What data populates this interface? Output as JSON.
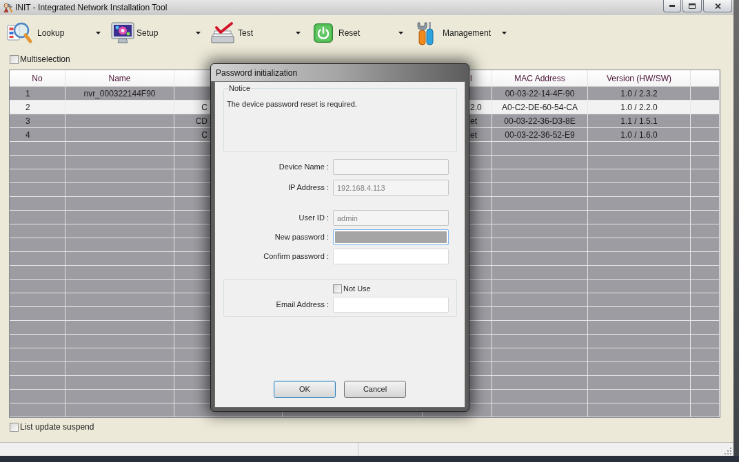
{
  "window": {
    "title": "INIT - Integrated Network Installation Tool"
  },
  "toolbar": [
    {
      "label": "Lookup"
    },
    {
      "label": "Setup"
    },
    {
      "label": "Test"
    },
    {
      "label": "Reset"
    },
    {
      "label": "Management"
    }
  ],
  "multiselection": {
    "label": "Multiselection",
    "checked": false
  },
  "table": {
    "columns": {
      "no": "No",
      "name": "Name",
      "column_5": "l",
      "mac_address": "MAC Address",
      "version": "Version (HW/SW)"
    },
    "rows": [
      {
        "no": "1",
        "name": "nvr_000322144F90",
        "mac_address": "00-03-22-14-4F-90",
        "version": "1.0 / 2.3.2",
        "selected": false
      },
      {
        "no": "2",
        "column_3": "C",
        "column_5": "2.0",
        "mac_address": "A0-C2-DE-60-54-CA",
        "version": "1.0 / 2.2.0",
        "selected": true
      },
      {
        "no": "3",
        "column_3": "CD",
        "column_5": "et",
        "mac_address": "00-03-22-36-D3-8E",
        "version": "1.1 / 1.5.1",
        "selected": false
      },
      {
        "no": "4",
        "column_3": "C",
        "column_5": "et",
        "mac_address": "00-03-22-36-52-E9",
        "version": "1.0 / 1.6.0",
        "selected": false
      }
    ]
  },
  "list_update_suspend": {
    "label": "List update suspend",
    "checked": false
  },
  "dialog": {
    "title": "Password initialization",
    "notice": {
      "legend": "Notice",
      "text": "The device password reset is required."
    },
    "device_fields": [
      {
        "label": "Device Name :",
        "disabled": true,
        "focused": false
      },
      {
        "label": "IP Address :",
        "value": "192.168.4.113",
        "disabled": true,
        "focused": false
      }
    ],
    "account_fields": [
      {
        "label": "User ID :",
        "value": "admin",
        "disabled": true,
        "focused": false
      },
      {
        "label": "New password :",
        "disabled": false,
        "focused": true
      },
      {
        "label": "Confirm password :",
        "disabled": false,
        "focused": false
      }
    ],
    "not_use": {
      "label": "Not Use",
      "checked": false
    },
    "email": {
      "label": "Email Address :",
      "disabled": false,
      "focused": false
    },
    "buttons": [
      {
        "label": "OK",
        "default": true
      },
      {
        "label": "Cancel",
        "default": false
      }
    ]
  }
}
